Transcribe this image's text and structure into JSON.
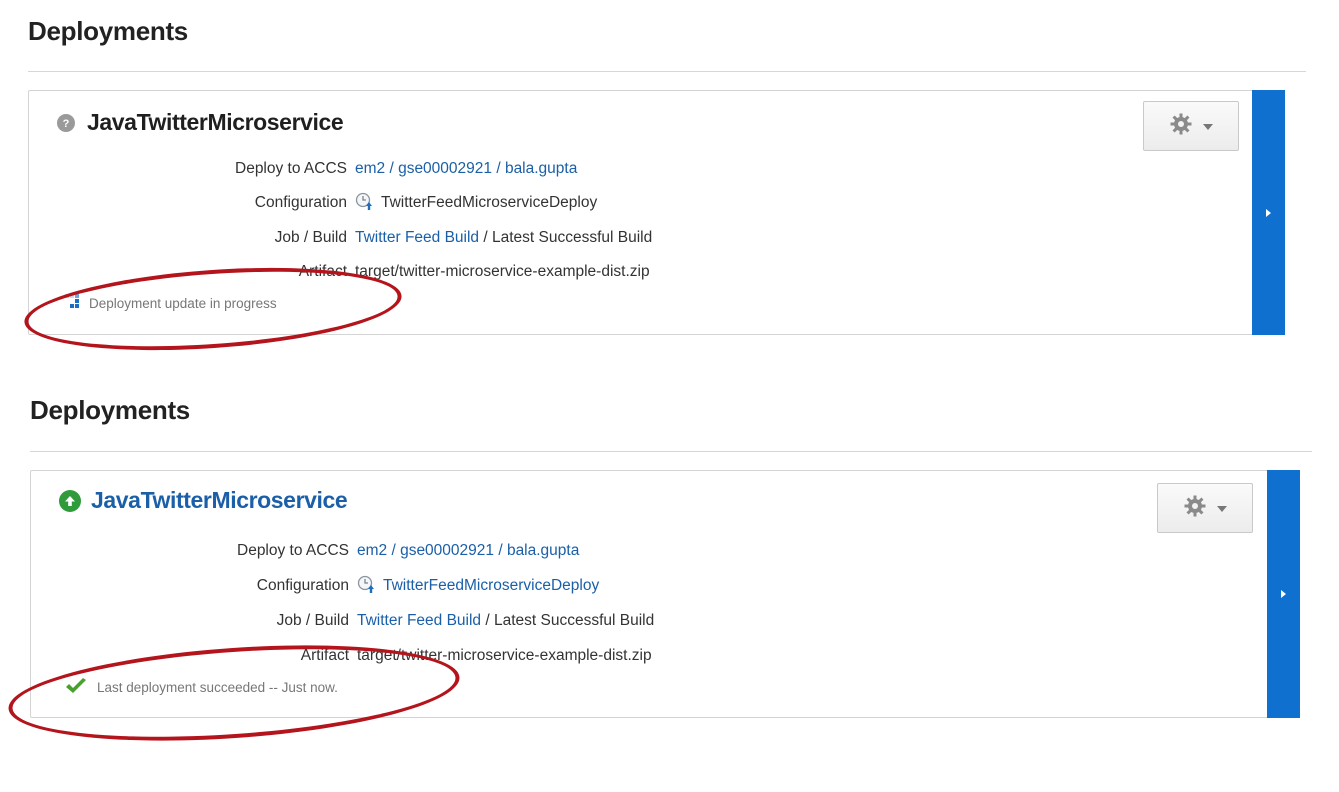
{
  "sections": [
    {
      "heading": "Deployments",
      "card": {
        "title": "JavaTwitterMicroservice",
        "title_is_link": false,
        "status_icon": "question-icon",
        "deploy_label": "Deploy to ACCS",
        "deploy_value": "em2 / gse00002921 / bala.gupta",
        "config_label": "Configuration",
        "config_value": "TwitterFeedMicroserviceDeploy",
        "config_is_link": false,
        "job_label": "Job / Build",
        "job_link": "Twitter Feed Build",
        "job_rest": " / Latest Successful Build",
        "artifact_label": "Artifact",
        "artifact_value": "target/twitter-microservice-example-dist.zip",
        "footer_icon": "progress-icon",
        "footer_text": "Deployment update in progress"
      }
    },
    {
      "heading": "Deployments",
      "card": {
        "title": "JavaTwitterMicroservice",
        "title_is_link": true,
        "status_icon": "up-arrow-icon",
        "deploy_label": "Deploy to ACCS",
        "deploy_value": "em2 / gse00002921 / bala.gupta",
        "config_label": "Configuration",
        "config_value": "TwitterFeedMicroserviceDeploy",
        "config_is_link": true,
        "job_label": "Job / Build",
        "job_link": "Twitter Feed Build",
        "job_rest": " / Latest Successful Build",
        "artifact_label": "Artifact",
        "artifact_value": "target/twitter-microservice-example-dist.zip",
        "footer_icon": "checkmark-icon",
        "footer_text": "Last deployment succeeded -- Just now."
      }
    }
  ],
  "colors": {
    "link": "#1a5fa8",
    "accent_bar": "#1070d0",
    "success": "#2f9b3b",
    "highlight_ellipse": "#b4141c"
  }
}
